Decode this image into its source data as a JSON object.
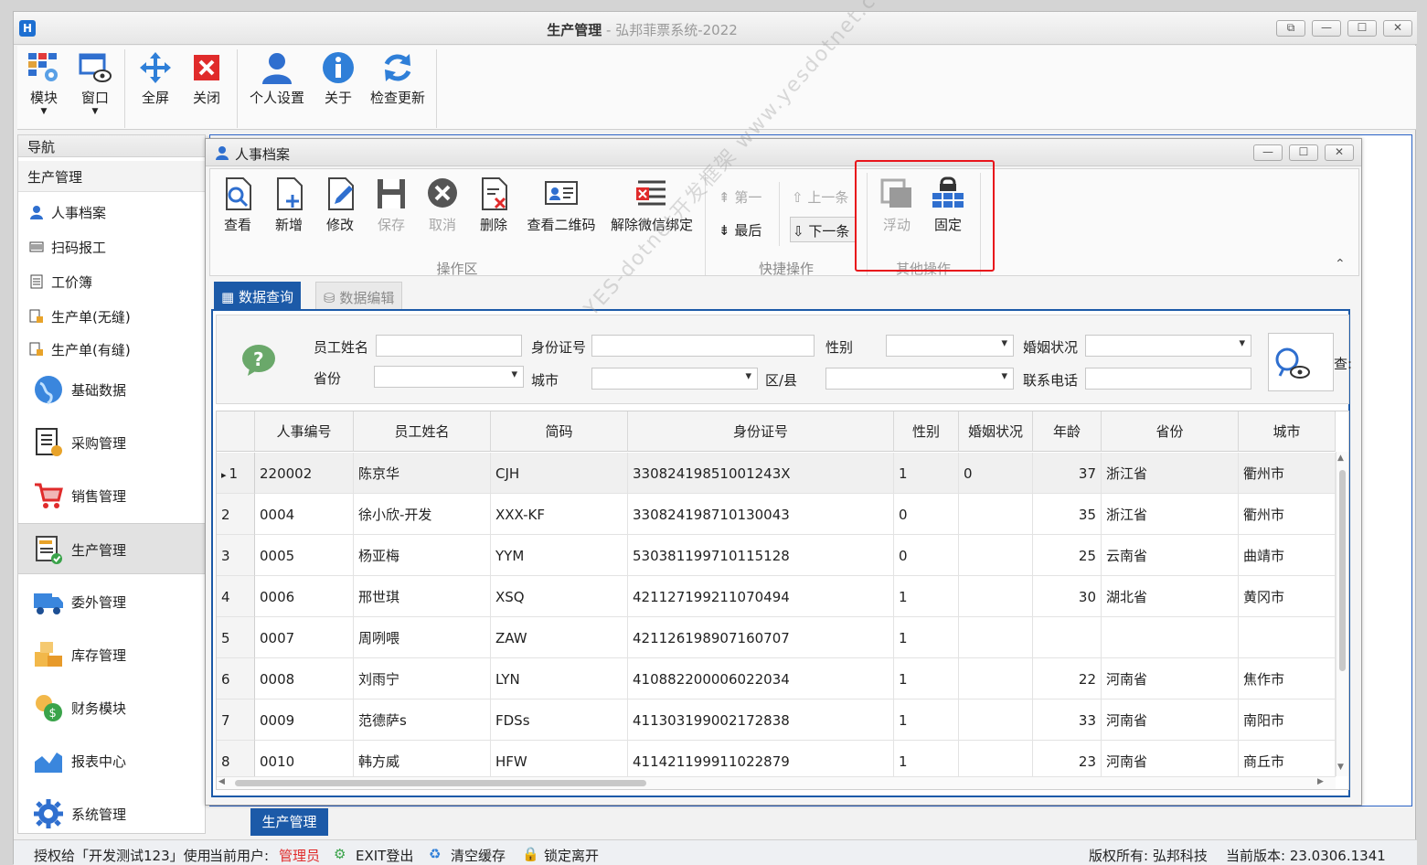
{
  "window": {
    "title_main": "生产管理",
    "title_sep": " - ",
    "title_app": "弘邦菲票系统-2022",
    "controls": [
      "⧉",
      "—",
      "☐",
      "✕"
    ]
  },
  "ribbon": {
    "buttons": [
      {
        "label": "模块",
        "icon": "modules-icon"
      },
      {
        "label": "窗口",
        "icon": "window-icon"
      },
      {
        "label": "全屏",
        "icon": "fullscreen-icon"
      },
      {
        "label": "关闭",
        "icon": "close-icon"
      },
      {
        "label": "个人设置",
        "icon": "user-settings-icon"
      },
      {
        "label": "关于",
        "icon": "info-icon"
      },
      {
        "label": "检查更新",
        "icon": "refresh-icon"
      }
    ]
  },
  "nav": {
    "header": "导航",
    "group": "生产管理",
    "sub_items": [
      "人事档案",
      "扫码报工",
      "工价簿",
      "生产单(无缝)",
      "生产单(有缝)"
    ],
    "main_items": [
      "基础数据",
      "采购管理",
      "销售管理",
      "生产管理",
      "委外管理",
      "库存管理",
      "财务模块",
      "报表中心",
      "系统管理"
    ]
  },
  "mdi": {
    "tab": "生产管理"
  },
  "status": {
    "auth": "授权给「开发测试123」使用",
    "user_label": "当前用户:",
    "user_name": "管理员",
    "exit": "EXIT登出",
    "clear": "清空缓存",
    "lock": "锁定离开",
    "copyright": "版权所有: 弘邦科技",
    "version": "当前版本: 23.0306.1341"
  },
  "child": {
    "title": "人事档案",
    "controls": [
      "—",
      "☐",
      "✕"
    ],
    "ops": [
      "查看",
      "新增",
      "修改",
      "保存",
      "取消",
      "删除",
      "查看二维码",
      "解除微信绑定"
    ],
    "ops_group": "操作区",
    "quick": {
      "first": "第一",
      "prev": "上一条",
      "last": "最后",
      "next": "下一条"
    },
    "quick_group": "快捷操作",
    "other": [
      "浮动",
      "固定"
    ],
    "other_group": "其他操作",
    "tabs": [
      "数据查询",
      "数据编辑"
    ],
    "search": {
      "name": "员工姓名",
      "idcard": "身份证号",
      "gender": "性别",
      "marriage": "婚姻状况",
      "province": "省份",
      "city": "城市",
      "district": "区/县",
      "phone": "联系电话",
      "query": "查:"
    },
    "watermark": "YES-dotnet开发框架 www.yesdotnet.com"
  },
  "grid": {
    "columns": [
      "人事编号",
      "员工姓名",
      "简码",
      "身份证号",
      "性别",
      "婚姻状况",
      "年龄",
      "省份",
      "城市"
    ],
    "rows": [
      [
        "1",
        "220002",
        "陈京华",
        "CJH",
        "33082419851001243X",
        "1",
        "0",
        "37",
        "浙江省",
        "衢州市"
      ],
      [
        "2",
        "0004",
        "徐小欣-开发",
        "XXX-KF",
        "330824198710130043",
        "0",
        "",
        "35",
        "浙江省",
        "衢州市"
      ],
      [
        "3",
        "0005",
        "杨亚梅",
        "YYM",
        "530381199710115128",
        "0",
        "",
        "25",
        "云南省",
        "曲靖市"
      ],
      [
        "4",
        "0006",
        "邢世琪",
        "XSQ",
        "421127199211070494",
        "1",
        "",
        "30",
        "湖北省",
        "黄冈市"
      ],
      [
        "5",
        "0007",
        "周咧喂",
        "ZAW",
        "421126198907160707",
        "1",
        "",
        "",
        "",
        ""
      ],
      [
        "6",
        "0008",
        "刘雨宁",
        "LYN",
        "410882200006022034",
        "1",
        "",
        "22",
        "河南省",
        "焦作市"
      ],
      [
        "7",
        "0009",
        "范德萨s",
        "FDSs",
        "411303199002172838",
        "1",
        "",
        "33",
        "河南省",
        "南阳市"
      ],
      [
        "8",
        "0010",
        "韩方威",
        "HFW",
        "411421199911022879",
        "1",
        "",
        "23",
        "河南省",
        "商丘市"
      ]
    ]
  }
}
